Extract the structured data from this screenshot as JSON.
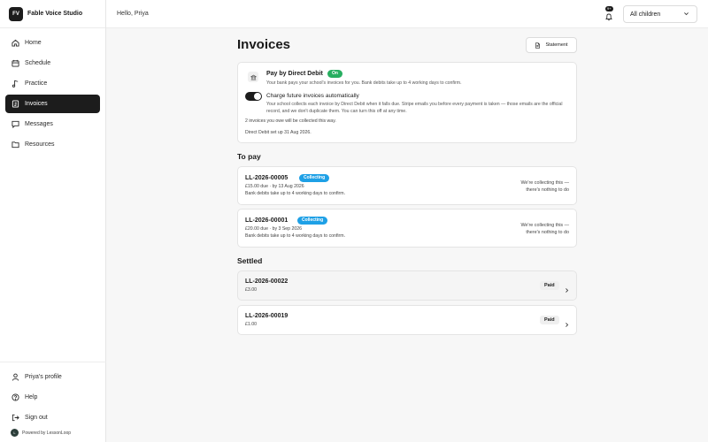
{
  "brand": {
    "initials": "FV",
    "name": "Fable Voice Studio"
  },
  "nav": {
    "items": [
      {
        "label": "Home",
        "icon": "home-icon"
      },
      {
        "label": "Schedule",
        "icon": "calendar-icon"
      },
      {
        "label": "Practice",
        "icon": "music-note-icon"
      },
      {
        "label": "Invoices",
        "icon": "invoice-icon",
        "active": true
      },
      {
        "label": "Messages",
        "icon": "message-icon"
      },
      {
        "label": "Resources",
        "icon": "folder-icon"
      }
    ],
    "bottom": [
      {
        "label": "Priya's profile",
        "icon": "user-icon"
      },
      {
        "label": "Help",
        "icon": "help-icon"
      },
      {
        "label": "Sign out",
        "icon": "sign-out-icon"
      }
    ],
    "powered_by": "Powered by LessonLoop"
  },
  "topbar": {
    "greeting": "Hello, Priya",
    "notification_badge": "9+",
    "child_select": "All children"
  },
  "page": {
    "title": "Invoices",
    "statement_label": "Statement"
  },
  "direct_debit": {
    "title": "Pay by Direct Debit",
    "status": "On",
    "subtitle": "Your bank pays your school's invoices for you. Bank debits take up to 4 working days to confirm.",
    "charge_title": "Charge future invoices automatically",
    "charge_desc": "Your school collects each invoice by Direct Debit when it falls due. Stripe emails you before every payment is taken — those emails are the official record, and we don't duplicate them. You can turn this off at any time.",
    "note_collected": "2 invoices you owe will be collected this way.",
    "note_setup": "Direct Debit set up 31 Aug 2026."
  },
  "to_pay": {
    "title": "To pay",
    "items": [
      {
        "number": "LL-2026-00005",
        "status": "Collecting",
        "due": "£15.00 due · by 13 Aug 2026",
        "confirm": "Bank debits take up to 4 working days to confirm.",
        "right_line1": "We're collecting this —",
        "right_line2": "there's nothing to do"
      },
      {
        "number": "LL-2026-00001",
        "status": "Collecting",
        "due": "£20.00 due · by 3 Sep 2026",
        "confirm": "Bank debits take up to 4 working days to confirm.",
        "right_line1": "We're collecting this —",
        "right_line2": "there's nothing to do"
      }
    ]
  },
  "settled": {
    "title": "Settled",
    "items": [
      {
        "number": "LL-2026-00022",
        "amount": "£3.00",
        "status": "Paid"
      },
      {
        "number": "LL-2026-00019",
        "amount": "£1.00",
        "status": "Paid"
      }
    ]
  },
  "colors": {
    "accent_dark": "#1c1c1c",
    "on_green": "#27ae60",
    "collecting_blue": "#1ea0e6"
  }
}
